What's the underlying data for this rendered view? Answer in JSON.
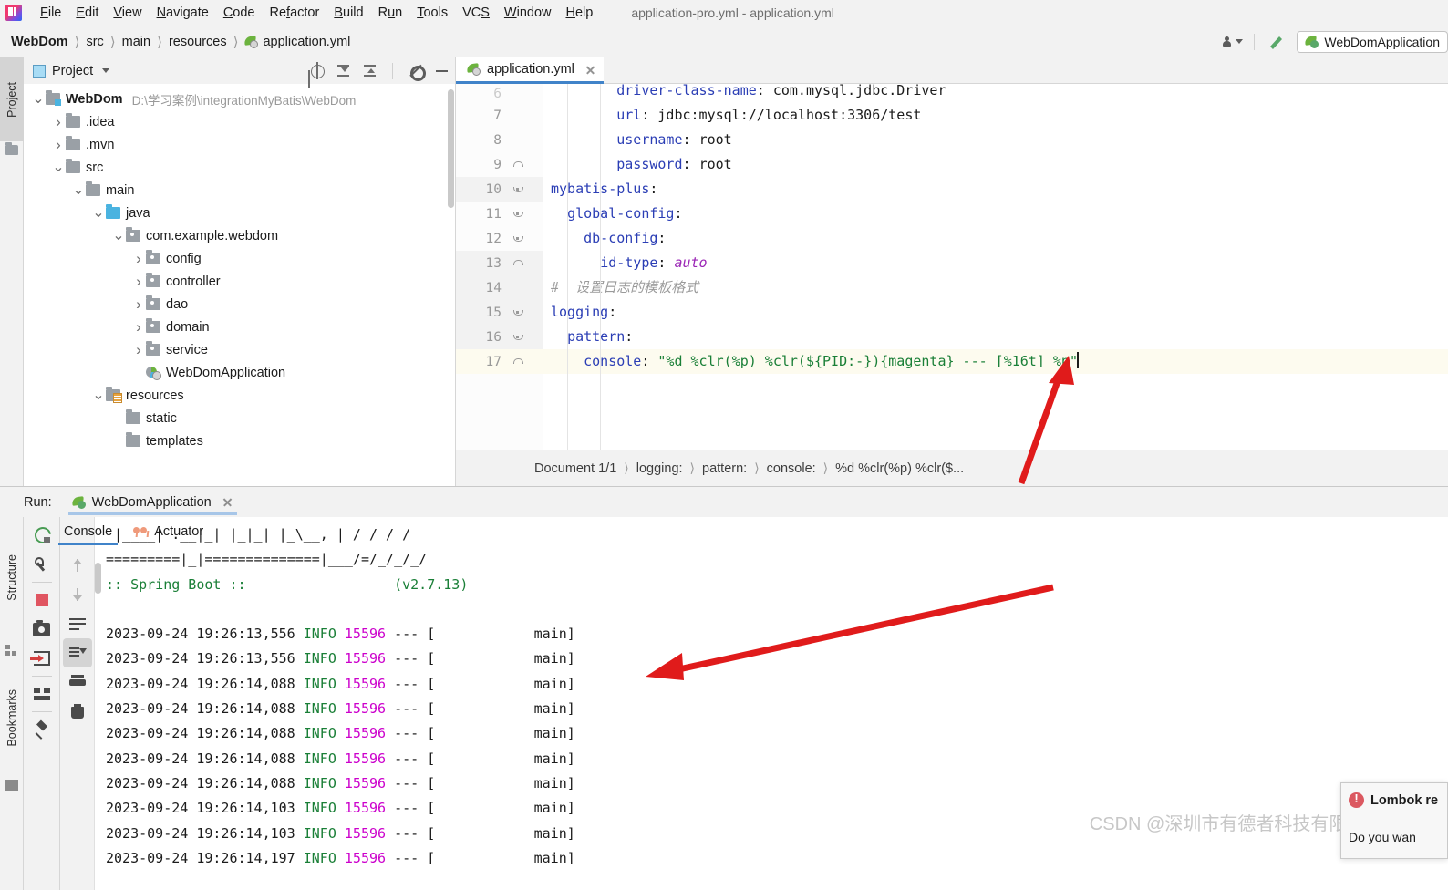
{
  "window": {
    "title": "application-pro.yml - application.yml"
  },
  "menubar": {
    "items": [
      "File",
      "Edit",
      "View",
      "Navigate",
      "Code",
      "Refactor",
      "Build",
      "Run",
      "Tools",
      "VCS",
      "Window",
      "Help"
    ]
  },
  "navbar": {
    "breadcrumbs": [
      "WebDom",
      "src",
      "main",
      "resources",
      "application.yml"
    ],
    "file_icon": "spring-leaf-icon",
    "user_icon": "person-icon",
    "build_icon": "hammer-icon",
    "run_config": "WebDomApplication"
  },
  "left_strip": {
    "project_label": "Project",
    "structure_label": "Structure",
    "bookmarks_label": "Bookmarks"
  },
  "project_panel": {
    "title": "Project",
    "toolbar": [
      "locate-icon",
      "expand-all-icon",
      "collapse-all-icon",
      "gear-icon",
      "minimize-icon"
    ],
    "tree": [
      {
        "depth": 0,
        "arrow": "v",
        "icon": "module-folder",
        "name": "WebDom",
        "bold": true,
        "path": "D:\\学习案例\\integrationMyBatis\\WebDom"
      },
      {
        "depth": 1,
        "arrow": ">",
        "icon": "folder",
        "name": ".idea",
        "bold": false,
        "path": ""
      },
      {
        "depth": 1,
        "arrow": ">",
        "icon": "folder",
        "name": ".mvn",
        "bold": false,
        "path": ""
      },
      {
        "depth": 1,
        "arrow": "v",
        "icon": "folder",
        "name": "src",
        "bold": false,
        "path": ""
      },
      {
        "depth": 2,
        "arrow": "v",
        "icon": "folder",
        "name": "main",
        "bold": false,
        "path": ""
      },
      {
        "depth": 3,
        "arrow": "v",
        "icon": "blue-folder",
        "name": "java",
        "bold": false,
        "path": ""
      },
      {
        "depth": 4,
        "arrow": "v",
        "icon": "package-folder",
        "name": "com.example.webdom",
        "bold": false,
        "path": ""
      },
      {
        "depth": 5,
        "arrow": ">",
        "icon": "package-folder",
        "name": "config",
        "bold": false,
        "path": ""
      },
      {
        "depth": 5,
        "arrow": ">",
        "icon": "package-folder",
        "name": "controller",
        "bold": false,
        "path": ""
      },
      {
        "depth": 5,
        "arrow": ">",
        "icon": "package-folder",
        "name": "dao",
        "bold": false,
        "path": ""
      },
      {
        "depth": 5,
        "arrow": ">",
        "icon": "package-folder",
        "name": "domain",
        "bold": false,
        "path": ""
      },
      {
        "depth": 5,
        "arrow": ">",
        "icon": "package-folder",
        "name": "service",
        "bold": false,
        "path": ""
      },
      {
        "depth": 5,
        "arrow": "",
        "icon": "spring-class",
        "name": "WebDomApplication",
        "bold": false,
        "path": ""
      },
      {
        "depth": 3,
        "arrow": "v",
        "icon": "resources-folder",
        "name": "resources",
        "bold": false,
        "path": ""
      },
      {
        "depth": 4,
        "arrow": "",
        "icon": "folder",
        "name": "static",
        "bold": false,
        "path": ""
      },
      {
        "depth": 4,
        "arrow": "",
        "icon": "folder",
        "name": "templates",
        "bold": false,
        "path": ""
      }
    ]
  },
  "editor": {
    "tab_label": "application.yml",
    "tab_icon": "spring-leaf-icon",
    "first_visible_line": 6,
    "current_line": 17,
    "lines": [
      {
        "n": 6,
        "fold": "",
        "clipped": true,
        "indent": 8,
        "tokens": [
          {
            "t": "driver-class-name",
            "c": "k"
          },
          {
            "t": ": ",
            "c": "v"
          },
          {
            "t": "com.mysql.jdbc.Driver",
            "c": "v"
          }
        ]
      },
      {
        "n": 7,
        "fold": "",
        "clipped": false,
        "indent": 8,
        "tokens": [
          {
            "t": "url",
            "c": "k"
          },
          {
            "t": ": ",
            "c": "v"
          },
          {
            "t": "jdbc:mysql://localhost:3306/test",
            "c": "v"
          }
        ]
      },
      {
        "n": 8,
        "fold": "",
        "clipped": false,
        "indent": 8,
        "tokens": [
          {
            "t": "username",
            "c": "k"
          },
          {
            "t": ": ",
            "c": "v"
          },
          {
            "t": "root",
            "c": "v"
          }
        ]
      },
      {
        "n": 9,
        "fold": "up",
        "clipped": false,
        "indent": 8,
        "tokens": [
          {
            "t": "password",
            "c": "k"
          },
          {
            "t": ": ",
            "c": "v"
          },
          {
            "t": "root",
            "c": "v"
          }
        ]
      },
      {
        "n": 10,
        "fold": "dn",
        "clipped": false,
        "indent": 0,
        "tokens": [
          {
            "t": "mybatis-plus",
            "c": "k"
          },
          {
            "t": ":",
            "c": "v"
          }
        ]
      },
      {
        "n": 11,
        "fold": "dn",
        "clipped": false,
        "indent": 2,
        "tokens": [
          {
            "t": "global-config",
            "c": "k"
          },
          {
            "t": ":",
            "c": "v"
          }
        ]
      },
      {
        "n": 12,
        "fold": "dn",
        "clipped": false,
        "indent": 4,
        "tokens": [
          {
            "t": "db-config",
            "c": "k"
          },
          {
            "t": ":",
            "c": "v"
          }
        ]
      },
      {
        "n": 13,
        "fold": "up",
        "clipped": false,
        "indent": 6,
        "tokens": [
          {
            "t": "id-type",
            "c": "k"
          },
          {
            "t": ": ",
            "c": "v"
          },
          {
            "t": "auto",
            "c": "en"
          }
        ]
      },
      {
        "n": 14,
        "fold": "",
        "clipped": false,
        "indent": 0,
        "tokens": [
          {
            "t": "#  设置日志的模板格式",
            "c": "cm"
          }
        ]
      },
      {
        "n": 15,
        "fold": "dn",
        "clipped": false,
        "indent": 0,
        "tokens": [
          {
            "t": "logging",
            "c": "k"
          },
          {
            "t": ":",
            "c": "v"
          }
        ]
      },
      {
        "n": 16,
        "fold": "dn",
        "clipped": false,
        "indent": 2,
        "tokens": [
          {
            "t": "pattern",
            "c": "k"
          },
          {
            "t": ":",
            "c": "v"
          }
        ]
      },
      {
        "n": 17,
        "fold": "up",
        "clipped": false,
        "indent": 4,
        "tokens": [
          {
            "t": "console",
            "c": "k"
          },
          {
            "t": ": ",
            "c": "v"
          },
          {
            "t": "\"%d %clr(%p) %clr(${",
            "c": "str"
          },
          {
            "t": "PID",
            "c": "str ul"
          },
          {
            "t": ":-}){magenta} --- [%16t] %n\"",
            "c": "str"
          }
        ]
      }
    ]
  },
  "breadcrumbs": {
    "items": [
      "Document 1/1",
      "logging:",
      "pattern:",
      "console:",
      "%d %clr(%p) %clr($..."
    ]
  },
  "run_panel": {
    "run_label": "Run:",
    "tab_label": "WebDomApplication",
    "tab_icon": "spring-leaf-run-icon",
    "left_toolbar": [
      "rerun-icon",
      "wrench-icon",
      "stop-icon",
      "camera-icon",
      "export-icon",
      "layout-icon",
      "pin-icon"
    ],
    "console_toolbar": [
      "scroll-up-icon",
      "scroll-down-icon",
      "soft-wrap-icon",
      "scroll-to-end-icon",
      "print-icon",
      "clear-all-icon"
    ],
    "tabs": [
      {
        "label": "Console",
        "icon": "",
        "active": true
      },
      {
        "label": "Actuator",
        "icon": "actuator-icon",
        "active": false
      }
    ],
    "console_lines": [
      {
        "type": "banner",
        "text": " |____| .__|_| |_|_| |_\\__, | / / / /"
      },
      {
        "type": "banner",
        "text": "=========|_|==============|___/=/_/_/_/"
      },
      {
        "type": "spring",
        "label": ":: Spring Boot ::",
        "version": "(v2.7.13)"
      },
      {
        "type": "blank",
        "text": ""
      },
      {
        "type": "log",
        "ts": "2023-09-24 19:26:13,556",
        "level": "INFO",
        "pid": "15596",
        "dash": "---",
        "thread": "main"
      },
      {
        "type": "log",
        "ts": "2023-09-24 19:26:13,556",
        "level": "INFO",
        "pid": "15596",
        "dash": "---",
        "thread": "main"
      },
      {
        "type": "log",
        "ts": "2023-09-24 19:26:14,088",
        "level": "INFO",
        "pid": "15596",
        "dash": "---",
        "thread": "main"
      },
      {
        "type": "log",
        "ts": "2023-09-24 19:26:14,088",
        "level": "INFO",
        "pid": "15596",
        "dash": "---",
        "thread": "main"
      },
      {
        "type": "log",
        "ts": "2023-09-24 19:26:14,088",
        "level": "INFO",
        "pid": "15596",
        "dash": "---",
        "thread": "main"
      },
      {
        "type": "log",
        "ts": "2023-09-24 19:26:14,088",
        "level": "INFO",
        "pid": "15596",
        "dash": "---",
        "thread": "main"
      },
      {
        "type": "log",
        "ts": "2023-09-24 19:26:14,088",
        "level": "INFO",
        "pid": "15596",
        "dash": "---",
        "thread": "main"
      },
      {
        "type": "log",
        "ts": "2023-09-24 19:26:14,103",
        "level": "INFO",
        "pid": "15596",
        "dash": "---",
        "thread": "main"
      },
      {
        "type": "log",
        "ts": "2023-09-24 19:26:14,103",
        "level": "INFO",
        "pid": "15596",
        "dash": "---",
        "thread": "main"
      },
      {
        "type": "log",
        "ts": "2023-09-24 19:26:14,197",
        "level": "INFO",
        "pid": "15596",
        "dash": "---",
        "thread": "main"
      }
    ]
  },
  "notification": {
    "icon": "error-icon",
    "title": "Lombok re",
    "body": "Do you wan"
  },
  "watermark": {
    "text": "CSDN @深圳市有德者科技有限公司-耿瑞"
  },
  "colors": {
    "accent": "#4083c9",
    "spring_green": "#6cb33e",
    "info_green": "#1a7f37",
    "pid_magenta": "#cc00cc",
    "annotation_red": "#e01b1b",
    "string_green": "#1a7f37",
    "key_blue": "#2b3eb5"
  }
}
